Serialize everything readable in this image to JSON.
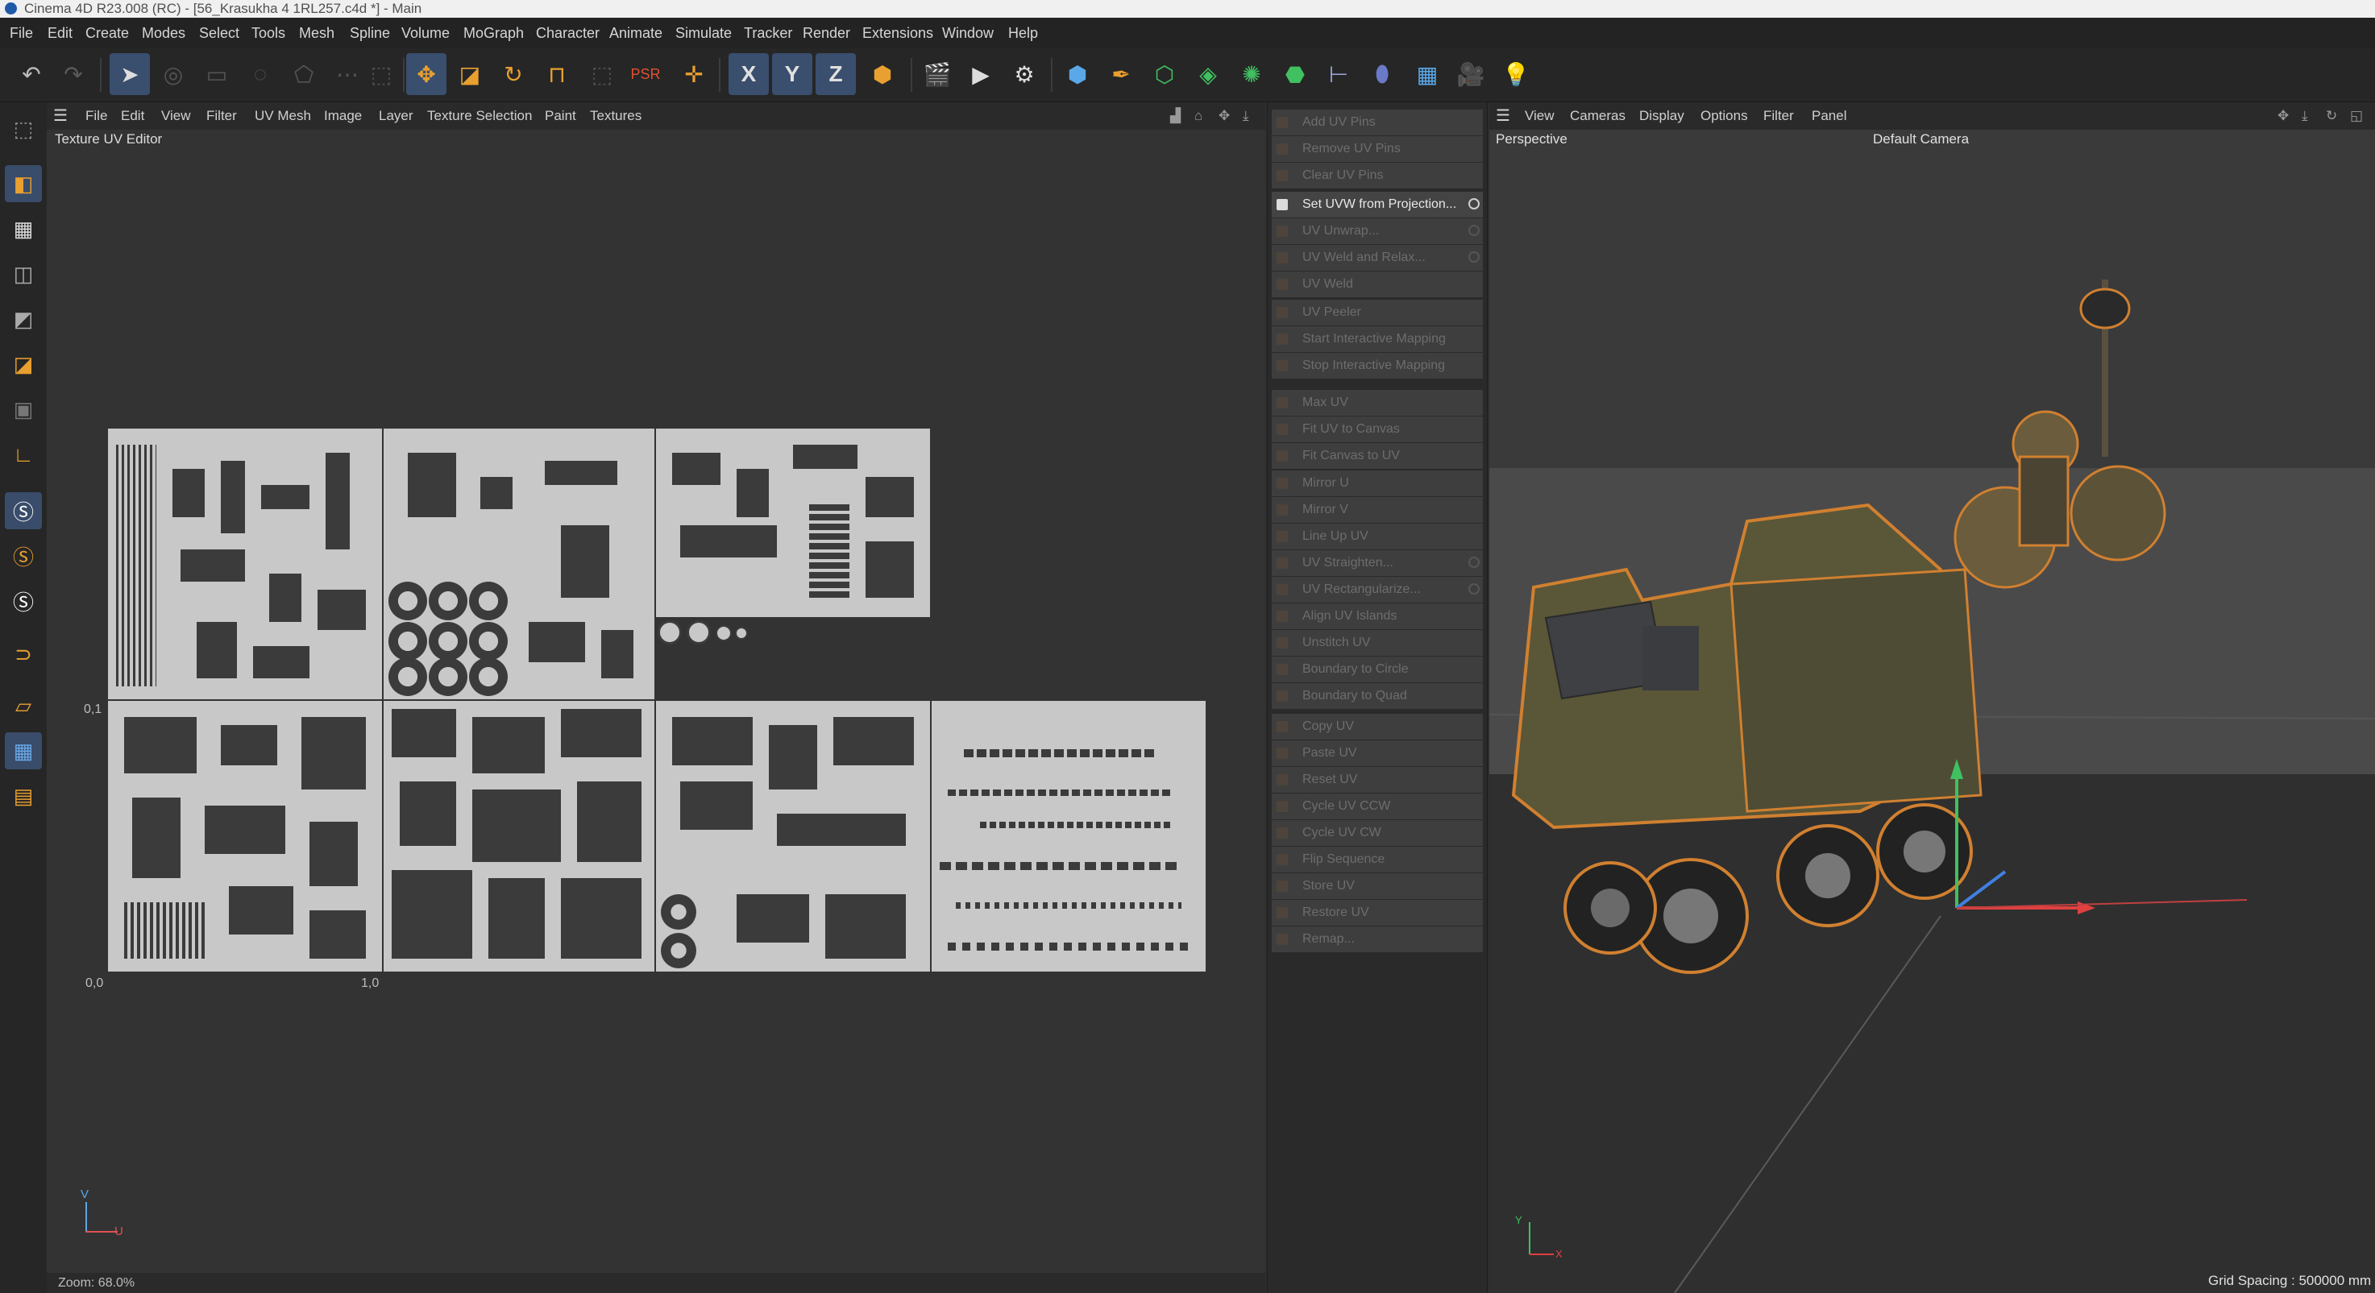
{
  "window": {
    "title": "Cinema 4D R23.008 (RC) - [56_Krasukha 4 1RL257.c4d *] - Main"
  },
  "menubar": [
    "File",
    "Edit",
    "Create",
    "Modes",
    "Select",
    "Tools",
    "Mesh",
    "Spline",
    "Volume",
    "MoGraph",
    "Character",
    "Animate",
    "Simulate",
    "Tracker",
    "Render",
    "Extensions",
    "Window",
    "Help"
  ],
  "toolbar": {
    "icons": [
      "undo-icon",
      "redo-icon",
      "select-arrow-icon",
      "live-selection-icon",
      "rectangle-select-icon",
      "lasso-select-icon",
      "polygon-select-icon",
      "select-more-icon",
      "move-icon",
      "scale-icon",
      "rotate-icon",
      "snap-icon",
      "transform-icon",
      "psr-icon",
      "axis-icon",
      "x-axis-icon",
      "y-axis-icon",
      "z-axis-icon",
      "coordinate-system-icon",
      "render-region-icon",
      "render-view-icon",
      "render-settings-icon",
      "cube-icon",
      "pen-icon",
      "subdivision-icon",
      "extrude-icon",
      "deformer-icon",
      "mograph-icon",
      "scene-icon",
      "field-icon",
      "floor-icon",
      "camera-icon",
      "light-icon"
    ],
    "axis_labels": [
      "X",
      "Y",
      "Z"
    ]
  },
  "uv_editor": {
    "menu": [
      "File",
      "Edit",
      "View",
      "Filter",
      "UV Mesh",
      "Image",
      "Layer",
      "Texture Selection",
      "Paint",
      "Textures"
    ],
    "title": "Texture UV Editor",
    "axis_labels": {
      "y_mid": "0,1",
      "x_start": "0,0",
      "x_mid": "1,0"
    },
    "gizmo": {
      "v": "V",
      "u": "U"
    },
    "zoom": "Zoom: 68.0%"
  },
  "commands": [
    {
      "label": "Add UV Pins",
      "active": false,
      "gear": false
    },
    {
      "label": "Remove UV Pins",
      "active": false,
      "gear": false
    },
    {
      "label": "Clear UV Pins",
      "active": false,
      "gear": false
    },
    {
      "label": "Set UVW from Projection...",
      "active": true,
      "gear": true
    },
    {
      "label": "UV Unwrap...",
      "active": false,
      "gear": true
    },
    {
      "label": "UV Weld and Relax...",
      "active": false,
      "gear": true
    },
    {
      "label": "UV Weld",
      "active": false,
      "gear": false
    },
    {
      "label": "UV Peeler",
      "active": false,
      "gear": false
    },
    {
      "label": "Start Interactive Mapping",
      "active": false,
      "gear": false
    },
    {
      "label": "Stop Interactive Mapping",
      "active": false,
      "gear": false
    },
    {
      "label": "Max UV",
      "active": false,
      "gear": false
    },
    {
      "label": "Fit UV to Canvas",
      "active": false,
      "gear": false
    },
    {
      "label": "Fit Canvas to UV",
      "active": false,
      "gear": false
    },
    {
      "label": "Mirror U",
      "active": false,
      "gear": false
    },
    {
      "label": "Mirror V",
      "active": false,
      "gear": false
    },
    {
      "label": "Line Up UV",
      "active": false,
      "gear": false
    },
    {
      "label": "UV Straighten...",
      "active": false,
      "gear": true
    },
    {
      "label": "UV Rectangularize...",
      "active": false,
      "gear": true
    },
    {
      "label": "Align UV Islands",
      "active": false,
      "gear": false
    },
    {
      "label": "Unstitch UV",
      "active": false,
      "gear": false
    },
    {
      "label": "Boundary to Circle",
      "active": false,
      "gear": false
    },
    {
      "label": "Boundary to Quad",
      "active": false,
      "gear": false
    },
    {
      "label": "Copy UV",
      "active": false,
      "gear": false
    },
    {
      "label": "Paste UV",
      "active": false,
      "gear": false
    },
    {
      "label": "Reset UV",
      "active": false,
      "gear": false
    },
    {
      "label": "Cycle UV CCW",
      "active": false,
      "gear": false
    },
    {
      "label": "Cycle UV CW",
      "active": false,
      "gear": false
    },
    {
      "label": "Flip Sequence",
      "active": false,
      "gear": false
    },
    {
      "label": "Store UV",
      "active": false,
      "gear": false
    },
    {
      "label": "Restore UV",
      "active": false,
      "gear": false
    },
    {
      "label": "Remap...",
      "active": false,
      "gear": false
    }
  ],
  "viewport": {
    "menu": [
      "View",
      "Cameras",
      "Display",
      "Options",
      "Filter",
      "Panel"
    ],
    "label": "Perspective",
    "camera": "Default Camera",
    "grid_spacing": "Grid Spacing : 500000 mm",
    "gizmo": {
      "y": "Y",
      "x": "X"
    }
  },
  "colors": {
    "accent": "#3a4e6e",
    "selection_outline": "#e08a2a",
    "background": "#2d2d2d"
  }
}
